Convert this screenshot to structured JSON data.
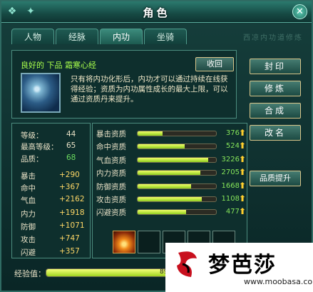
{
  "window": {
    "title": "角色",
    "faint_title": "西凉内功道修炼"
  },
  "tabs": [
    {
      "label": "人物",
      "active": false
    },
    {
      "label": "经脉",
      "active": false
    },
    {
      "label": "内功",
      "active": true
    },
    {
      "label": "坐骑",
      "active": false
    }
  ],
  "item": {
    "name": "良好的 下品 霜寒心经",
    "recall_label": "收回",
    "description": "只有将内功化形后，内功才可以通过持续在线获得经验；资质为内功属性成长的最大上限，可以通过资质丹来提升。"
  },
  "side_buttons": {
    "seal": "封印",
    "cultivate": "修炼",
    "combine": "合成",
    "rename": "改名",
    "upgrade_quality": "品质提升"
  },
  "basic_stats": [
    {
      "label": "等级：",
      "value": "44",
      "green": false
    },
    {
      "label": "最高等级：",
      "value": "65",
      "green": false
    },
    {
      "label": "品质：",
      "value": "68",
      "green": true
    }
  ],
  "attributes": [
    {
      "label": "暴击",
      "value": "+290"
    },
    {
      "label": "命中",
      "value": "+367"
    },
    {
      "label": "气血",
      "value": "+2162"
    },
    {
      "label": "内力",
      "value": "+1918"
    },
    {
      "label": "防御",
      "value": "+1071"
    },
    {
      "label": "攻击",
      "value": "+747"
    },
    {
      "label": "闪避",
      "value": "+357"
    }
  ],
  "qualities": [
    {
      "label": "暴击资质",
      "value": "376",
      "fill": 0.32
    },
    {
      "label": "命中资质",
      "value": "524",
      "fill": 0.6
    },
    {
      "label": "气血资质",
      "value": "3226",
      "fill": 0.9
    },
    {
      "label": "内力资质",
      "value": "2705",
      "fill": 0.8
    },
    {
      "label": "防御资质",
      "value": "1668",
      "fill": 0.68
    },
    {
      "label": "攻击资质",
      "value": "1108",
      "fill": 0.82
    },
    {
      "label": "闪避资质",
      "value": "477",
      "fill": 0.62
    }
  ],
  "skill_slots": [
    "fire-skill-icon",
    "",
    "",
    "",
    "",
    ""
  ],
  "experience": {
    "label": "经验值：",
    "text": "89.58%",
    "fraction": 0.8958
  },
  "watermark": {
    "name": "梦芭莎",
    "url": "www.moobasa.com"
  }
}
